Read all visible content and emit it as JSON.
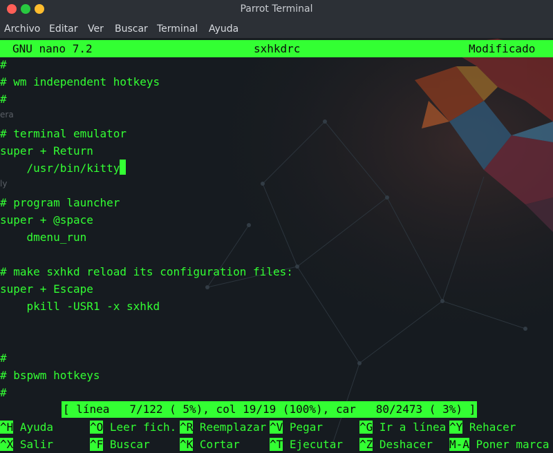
{
  "window": {
    "title": "Parrot Terminal"
  },
  "menu": [
    "Archivo",
    "Editar",
    "Ver",
    "Buscar",
    "Terminal",
    "Ayuda"
  ],
  "nano": {
    "version": "GNU nano 7.2",
    "filename": "sxhkdrc",
    "state": "Modificado"
  },
  "lines": [
    "#",
    "# wm independent hotkeys",
    "#",
    "",
    "# terminal emulator",
    "super + Return",
    "    /usr/bin/kitty",
    "",
    "# program launcher",
    "super + @space",
    "    dmenu_run",
    "",
    "# make sxhkd reload its configuration files:",
    "super + Escape",
    "    pkill -USR1 -x sxhkd",
    "",
    "",
    "#",
    "# bspwm hotkeys",
    "#"
  ],
  "ghost_text": [
    "era",
    "ly"
  ],
  "status": "[ línea   7/122 ( 5%), col 19/19 (100%), car   80/2473 ( 3%) ]",
  "shortcuts": [
    {
      "key": "^H",
      "label": " Ayuda"
    },
    {
      "key": "^O",
      "label": " Leer fich."
    },
    {
      "key": "^R",
      "label": " Reemplazar"
    },
    {
      "key": "^V",
      "label": " Pegar"
    },
    {
      "key": "^G",
      "label": " Ir a línea"
    },
    {
      "key": "^Y",
      "label": " Rehacer"
    },
    {
      "key": "^X",
      "label": " Salir"
    },
    {
      "key": "^F",
      "label": " Buscar"
    },
    {
      "key": "^K",
      "label": " Cortar"
    },
    {
      "key": "^T",
      "label": " Ejecutar"
    },
    {
      "key": "^Z",
      "label": " Deshacer"
    },
    {
      "key": "M-A",
      "label": " Poner marca"
    }
  ],
  "colors": {
    "accent": "#33ff33",
    "background": "#161b20"
  }
}
